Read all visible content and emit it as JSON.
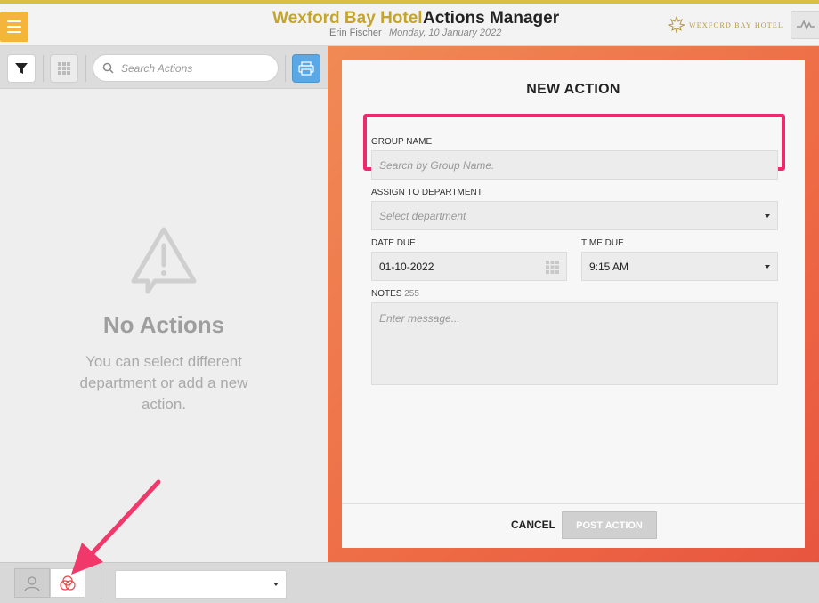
{
  "header": {
    "hotel_name": "Wexford Bay Hotel",
    "app_title": "Actions Manager",
    "user_name": "Erin Fischer",
    "date": "Monday, 10 January 2022",
    "logo_text": "WEXFORD BAY HOTEL",
    "accent_color": "#c3a42c",
    "icons": {
      "menu": "hamburger-icon",
      "logo": "maple-leaf-icon",
      "activity": "pulse-icon"
    }
  },
  "left_pane": {
    "search_placeholder": "Search Actions",
    "icons": {
      "filter": "funnel-icon",
      "grid": "grid-icon",
      "search": "search-icon",
      "print": "printer-icon",
      "warning": "warning-icon"
    },
    "empty_title": "No Actions",
    "empty_subtitle": "You can select different department or add a new action."
  },
  "form": {
    "title": "NEW ACTION",
    "group_name_label": "GROUP NAME",
    "group_name_placeholder": "Search by Group Name.",
    "department_label": "ASSIGN TO DEPARTMENT",
    "department_placeholder": "Select department",
    "date_due_label": "DATE DUE",
    "date_due_value": "01-10-2022",
    "time_due_label": "TIME DUE",
    "time_due_value": "9:15 AM",
    "notes_label": "NOTES",
    "notes_count": "255",
    "notes_placeholder": "Enter message...",
    "cancel_label": "CANCEL",
    "post_label": "POST ACTION",
    "highlight_color": "#ee2a6e"
  },
  "bottom_bar": {
    "icons": {
      "user": "user-icon",
      "circles": "venn-circles-icon"
    },
    "select_value": ""
  }
}
